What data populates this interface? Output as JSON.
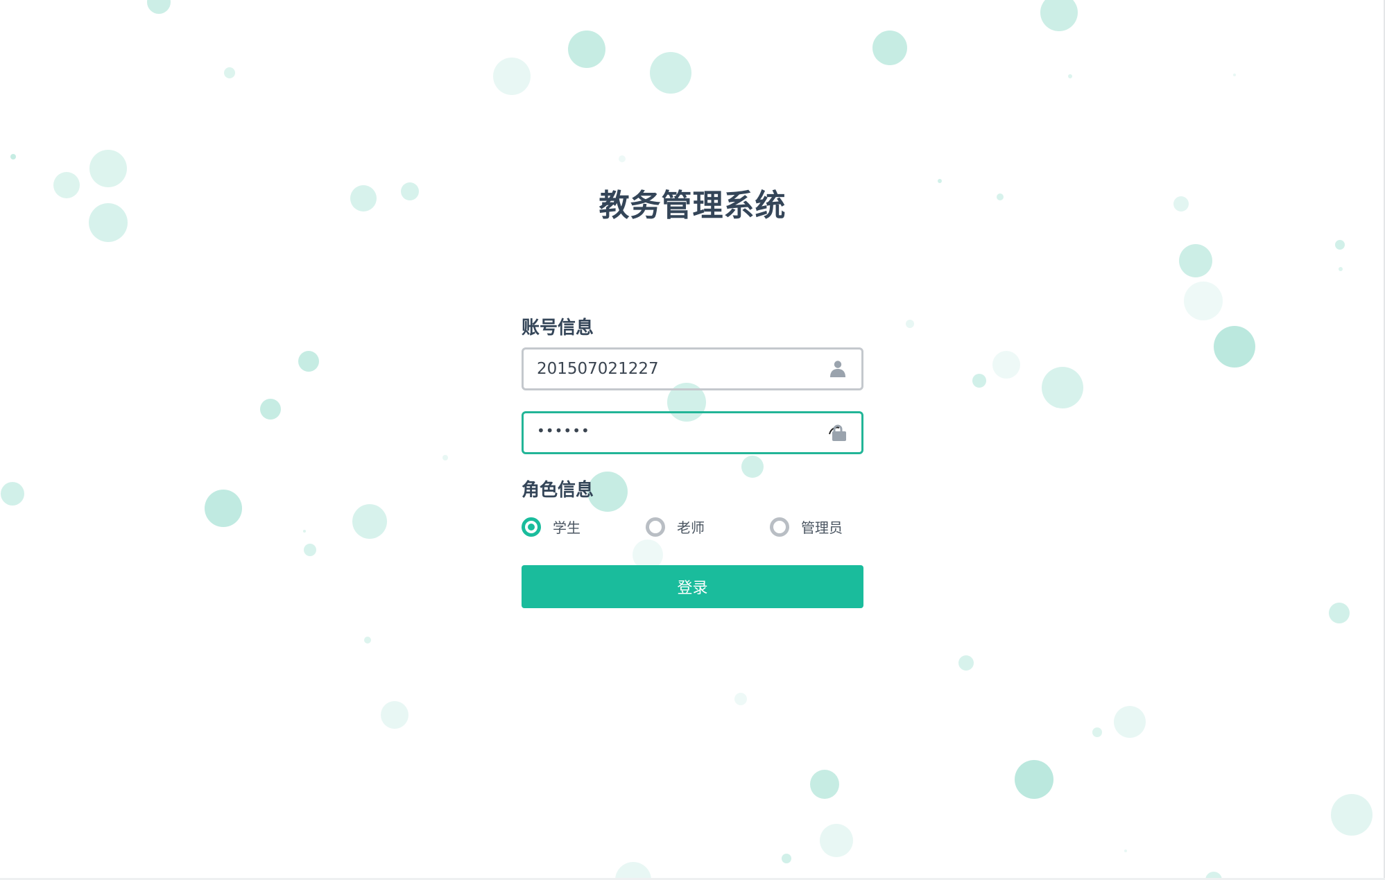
{
  "app": {
    "title": "教务管理系统"
  },
  "account": {
    "label": "账号信息",
    "username_value": "201507021227",
    "password_value": "••••••",
    "username_icon": "user-icon",
    "password_icon": "lock-icon"
  },
  "role": {
    "label": "角色信息",
    "options": [
      "学生",
      "老师",
      "管理员"
    ],
    "selected": "学生"
  },
  "actions": {
    "login_label": "登录"
  },
  "colors": {
    "accent": "#1abc9c",
    "title_text": "#344558",
    "bubble": "#8dd9c8"
  }
}
